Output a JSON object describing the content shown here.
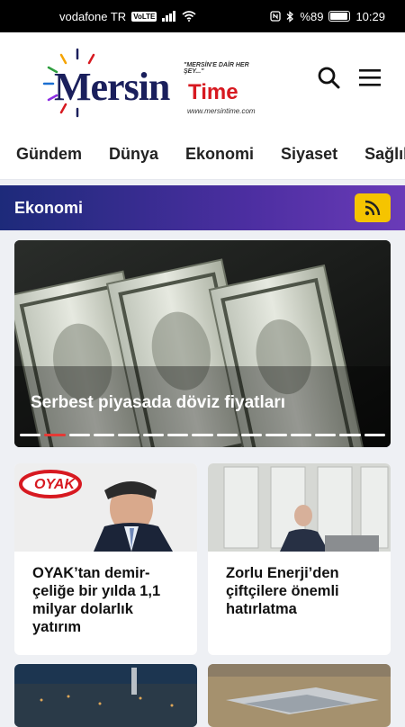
{
  "status": {
    "carrier": "vodafone TR",
    "volte": "VoLTE",
    "battery": "%89",
    "time": "10:29"
  },
  "brand": {
    "name": "Mersin",
    "name2": "Time",
    "tagline": "\"MERSİN'E DAİR HER ŞEY...\"",
    "url": "www.mersintime.com"
  },
  "nav": [
    "Gündem",
    "Dünya",
    "Ekonomi",
    "Siyaset",
    "Sağlık"
  ],
  "section": {
    "title": "Ekonomi"
  },
  "hero": {
    "caption": "Serbest piyasada döviz fiyatları",
    "slides": 15,
    "active_slide": 2
  },
  "cards": [
    {
      "title": "OYAK’tan demir-çeliğe bir yılda 1,1 milyar dolarlık yatırım",
      "logo": "OYAK"
    },
    {
      "title": "Zorlu Enerji’den çiftçilere önemli hatırlatma"
    }
  ],
  "colors": {
    "accent": "#f5c400",
    "brand_red": "#d71920",
    "brand_navy": "#1a1f5c"
  }
}
